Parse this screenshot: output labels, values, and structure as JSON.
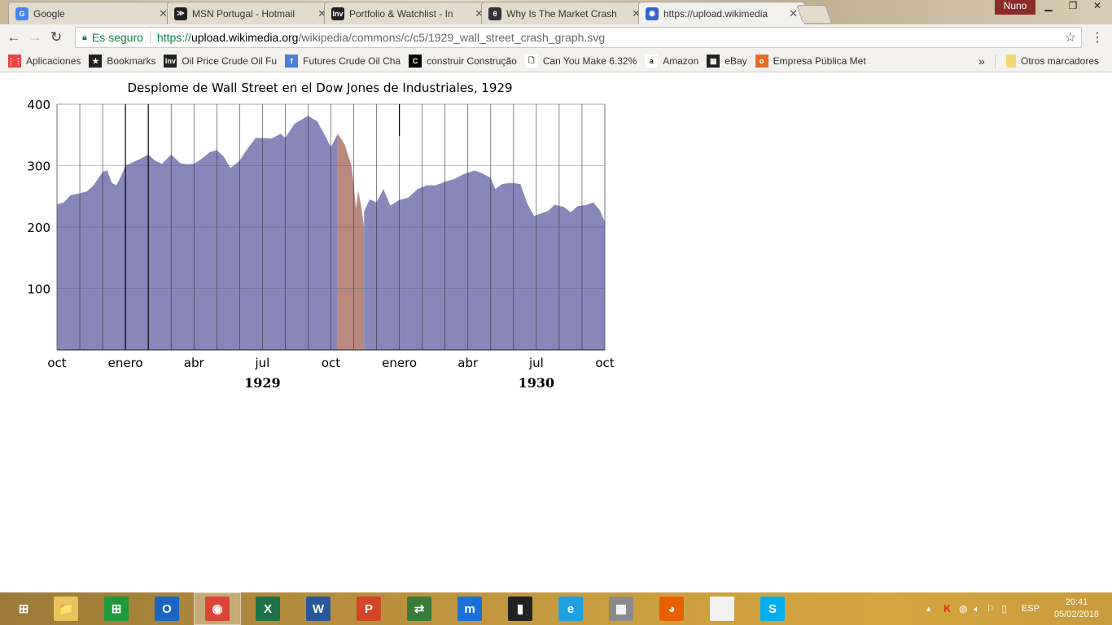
{
  "browser": {
    "tabs": [
      {
        "title": "Google",
        "icon": "google-icon",
        "color": "#4285f4",
        "glyph": "G",
        "active": false
      },
      {
        "title": "MSN Portugal - Hotmail",
        "icon": "msn-icon",
        "color": "#222",
        "glyph": "≫",
        "active": false
      },
      {
        "title": "Portfolio & Watchlist - In",
        "icon": "investing-icon",
        "color": "#222",
        "glyph": "Inv",
        "active": false
      },
      {
        "title": "Why Is The Market Crash",
        "icon": "quora-icon",
        "color": "#333",
        "glyph": "θ",
        "active": false
      },
      {
        "title": "https://upload.wikimedia",
        "icon": "wikimedia-icon",
        "color": "#36c",
        "glyph": "◉",
        "active": true
      }
    ],
    "user": "Nuno",
    "secure_label": "Es seguro",
    "url_prefix": "https://",
    "url_host": "upload.wikimedia.org",
    "url_path": "/wikipedia/commons/c/c5/1929_wall_street_crash_graph.svg",
    "bookmarks": [
      {
        "label": "Aplicaciones",
        "icon": "apps-icon",
        "color": "#e44",
        "glyph": "⋮⋮"
      },
      {
        "label": "Bookmarks",
        "icon": "star-icon",
        "color": "#222",
        "glyph": "★"
      },
      {
        "label": "Oil Price  Crude Oil Fu",
        "icon": "investing-icon",
        "color": "#222",
        "glyph": "Inv"
      },
      {
        "label": "Futures Crude Oil Cha",
        "icon": "facebook-icon",
        "color": "#4a7fd8",
        "glyph": "f"
      },
      {
        "label": "construir Construção",
        "icon": "c-icon",
        "color": "#000",
        "glyph": "C"
      },
      {
        "label": "Can You Make 6.32%",
        "icon": "page-icon",
        "color": "#fff",
        "glyph": "🗋"
      },
      {
        "label": "Amazon",
        "icon": "amazon-icon",
        "color": "#fff",
        "glyph": "a"
      },
      {
        "label": "eBay",
        "icon": "ebay-icon",
        "color": "#222",
        "glyph": "▦"
      },
      {
        "label": "Empresa Pública Met",
        "icon": "ouro-icon",
        "color": "#e86a2a",
        "glyph": "o"
      }
    ],
    "more": "»",
    "other_bookmarks": "Otros marcadores"
  },
  "chart_data": {
    "type": "area",
    "title": "Desplome de Wall Street en el Dow Jones de Industriales, 1929",
    "xlabel": "",
    "ylabel": "",
    "ylim": [
      0,
      400
    ],
    "yticks": [
      100,
      200,
      300,
      400
    ],
    "x_unit": "months since Oct 1928",
    "xlim": [
      0,
      24
    ],
    "xticks": [
      {
        "x": 0,
        "label": "oct"
      },
      {
        "x": 3,
        "label": "enero"
      },
      {
        "x": 6,
        "label": "abr"
      },
      {
        "x": 9,
        "label": "jul"
      },
      {
        "x": 12,
        "label": "oct"
      },
      {
        "x": 15,
        "label": "enero"
      },
      {
        "x": 18,
        "label": "abr"
      },
      {
        "x": 21,
        "label": "jul"
      },
      {
        "x": 24,
        "label": "oct"
      }
    ],
    "year_labels": [
      {
        "x": 9,
        "label": "1929"
      },
      {
        "x": 21,
        "label": "1930"
      }
    ],
    "grid": true,
    "series": [
      {
        "name": "before-crash",
        "color": "#8787ba",
        "points": [
          [
            0,
            237
          ],
          [
            0.3,
            240
          ],
          [
            0.6,
            252
          ],
          [
            1,
            255
          ],
          [
            1.3,
            258
          ],
          [
            1.6,
            268
          ],
          [
            2,
            290
          ],
          [
            2.2,
            292
          ],
          [
            2.4,
            272
          ],
          [
            2.6,
            268
          ],
          [
            2.8,
            282
          ],
          [
            3,
            300
          ],
          [
            3.3,
            305
          ],
          [
            3.6,
            310
          ],
          [
            4,
            318
          ],
          [
            4.3,
            308
          ],
          [
            4.6,
            303
          ],
          [
            5,
            318
          ],
          [
            5.4,
            304
          ],
          [
            5.7,
            302
          ],
          [
            6,
            303
          ],
          [
            6.3,
            310
          ],
          [
            6.7,
            322
          ],
          [
            7,
            325
          ],
          [
            7.3,
            315
          ],
          [
            7.6,
            296
          ],
          [
            8,
            308
          ],
          [
            8.3,
            325
          ],
          [
            8.7,
            345
          ],
          [
            9,
            345
          ],
          [
            9.4,
            344
          ],
          [
            9.8,
            352
          ],
          [
            10,
            345
          ],
          [
            10.4,
            368
          ],
          [
            11,
            381
          ],
          [
            11.4,
            372
          ],
          [
            11.8,
            345
          ],
          [
            12,
            330
          ],
          [
            12.3,
            352
          ]
        ]
      },
      {
        "name": "crash",
        "color": "#b98980",
        "points": [
          [
            12.3,
            352
          ],
          [
            12.6,
            335
          ],
          [
            12.9,
            300
          ],
          [
            13,
            270
          ],
          [
            13.1,
            230
          ],
          [
            13.2,
            260
          ],
          [
            13.35,
            228
          ],
          [
            13.45,
            200
          ]
        ]
      },
      {
        "name": "after-crash",
        "color": "#8787ba",
        "points": [
          [
            13.45,
            225
          ],
          [
            13.7,
            245
          ],
          [
            14,
            240
          ],
          [
            14.3,
            262
          ],
          [
            14.6,
            235
          ],
          [
            15,
            244
          ],
          [
            15.4,
            248
          ],
          [
            15.8,
            262
          ],
          [
            16.2,
            268
          ],
          [
            16.6,
            268
          ],
          [
            17,
            274
          ],
          [
            17.4,
            278
          ],
          [
            17.8,
            286
          ],
          [
            18.3,
            292
          ],
          [
            18.6,
            288
          ],
          [
            19,
            280
          ],
          [
            19.2,
            262
          ],
          [
            19.5,
            270
          ],
          [
            19.9,
            272
          ],
          [
            20.3,
            270
          ],
          [
            20.6,
            238
          ],
          [
            20.9,
            218
          ],
          [
            21.2,
            222
          ],
          [
            21.5,
            226
          ],
          [
            21.8,
            236
          ],
          [
            22.2,
            233
          ],
          [
            22.5,
            224
          ],
          [
            22.8,
            234
          ],
          [
            23.2,
            236
          ],
          [
            23.5,
            240
          ],
          [
            23.8,
            226
          ],
          [
            24,
            208
          ]
        ]
      }
    ]
  },
  "taskbar": {
    "apps": [
      {
        "name": "start-button",
        "icon": "windows-icon",
        "color": "transparent",
        "glyph": "⊞"
      },
      {
        "name": "file-explorer",
        "icon": "folder-icon",
        "color": "#e8c45a",
        "glyph": "📁"
      },
      {
        "name": "store",
        "icon": "store-icon",
        "color": "#1c9a3c",
        "glyph": "⊞"
      },
      {
        "name": "outlook",
        "icon": "outlook-icon",
        "color": "#1a64c2",
        "glyph": "O"
      },
      {
        "name": "chrome",
        "icon": "chrome-icon",
        "color": "#db4437",
        "glyph": "◉"
      },
      {
        "name": "excel",
        "icon": "excel-icon",
        "color": "#1e7145",
        "glyph": "X"
      },
      {
        "name": "word",
        "icon": "word-icon",
        "color": "#2b579a",
        "glyph": "W"
      },
      {
        "name": "powerpoint",
        "icon": "powerpoint-icon",
        "color": "#d24726",
        "glyph": "P"
      },
      {
        "name": "green-app",
        "icon": "app-icon",
        "color": "#3a7a3a",
        "glyph": "⇄"
      },
      {
        "name": "maxthon",
        "icon": "maxthon-icon",
        "color": "#1a6fd8",
        "glyph": "m"
      },
      {
        "name": "chart-app",
        "icon": "chart-icon",
        "color": "#222",
        "glyph": "▮"
      },
      {
        "name": "internet-explorer",
        "icon": "ie-icon",
        "color": "#1fa0e0",
        "glyph": "e"
      },
      {
        "name": "calculator",
        "icon": "calculator-icon",
        "color": "#8a8a8a",
        "glyph": "▦"
      },
      {
        "name": "firefox",
        "icon": "firefox-icon",
        "color": "#e66000",
        "glyph": "◕"
      },
      {
        "name": "file",
        "icon": "document-icon",
        "color": "#f2f2f2",
        "glyph": ""
      },
      {
        "name": "skype",
        "icon": "skype-icon",
        "color": "#00aff0",
        "glyph": "S"
      }
    ],
    "language": "ESP",
    "time": "20:41",
    "date": "05/02/2018"
  }
}
